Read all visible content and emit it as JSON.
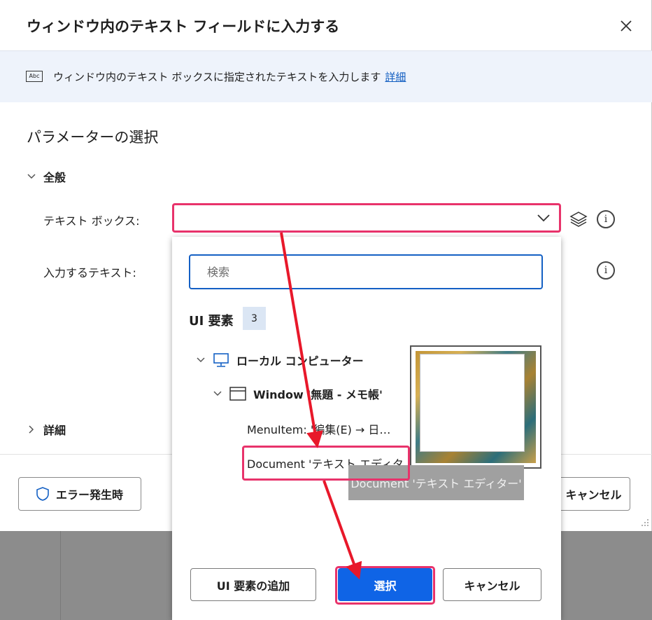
{
  "dialog": {
    "title": "ウィンドウ内のテキスト フィールドに入力する",
    "info_text": "ウィンドウ内のテキスト ボックスに指定されたテキストを入力します",
    "info_link": "詳細",
    "abc_icon_text": "Abc",
    "section_title": "パラメーターの選択",
    "group_general": "全般",
    "group_advanced": "詳細",
    "params": {
      "textbox_label": "テキスト ボックス:",
      "textbox_value": "",
      "text_to_enter_label": "入力するテキスト:"
    },
    "error_button": "エラー発生時",
    "cancel_button": "キャンセル"
  },
  "picker": {
    "search_placeholder": "検索",
    "ui_elements_title": "UI 要素",
    "ui_elements_count": "3",
    "tree": {
      "computer": "ローカル コンピューター",
      "window": "Window '無題 - メモ帳'",
      "menu_item": "MenuItem: '編集(E) → 日…",
      "document": "Document 'テキスト エディタ…"
    },
    "tooltip": "Document 'テキスト エディター'",
    "buttons": {
      "add": "UI 要素の追加",
      "select": "選択",
      "cancel": "キャンセル"
    }
  },
  "colors": {
    "accent_blue": "#0f64e6",
    "highlight_pink": "#e8336b",
    "arrow_red": "#e8182a",
    "info_bar": "#eef3fb",
    "link": "#0f5cc0"
  },
  "icons": [
    "close-icon",
    "abc-icon",
    "chevron-down-icon",
    "chevron-right-icon",
    "layers-icon",
    "info-icon",
    "shield-icon",
    "computer-icon",
    "window-icon",
    "resize-grip-icon"
  ]
}
